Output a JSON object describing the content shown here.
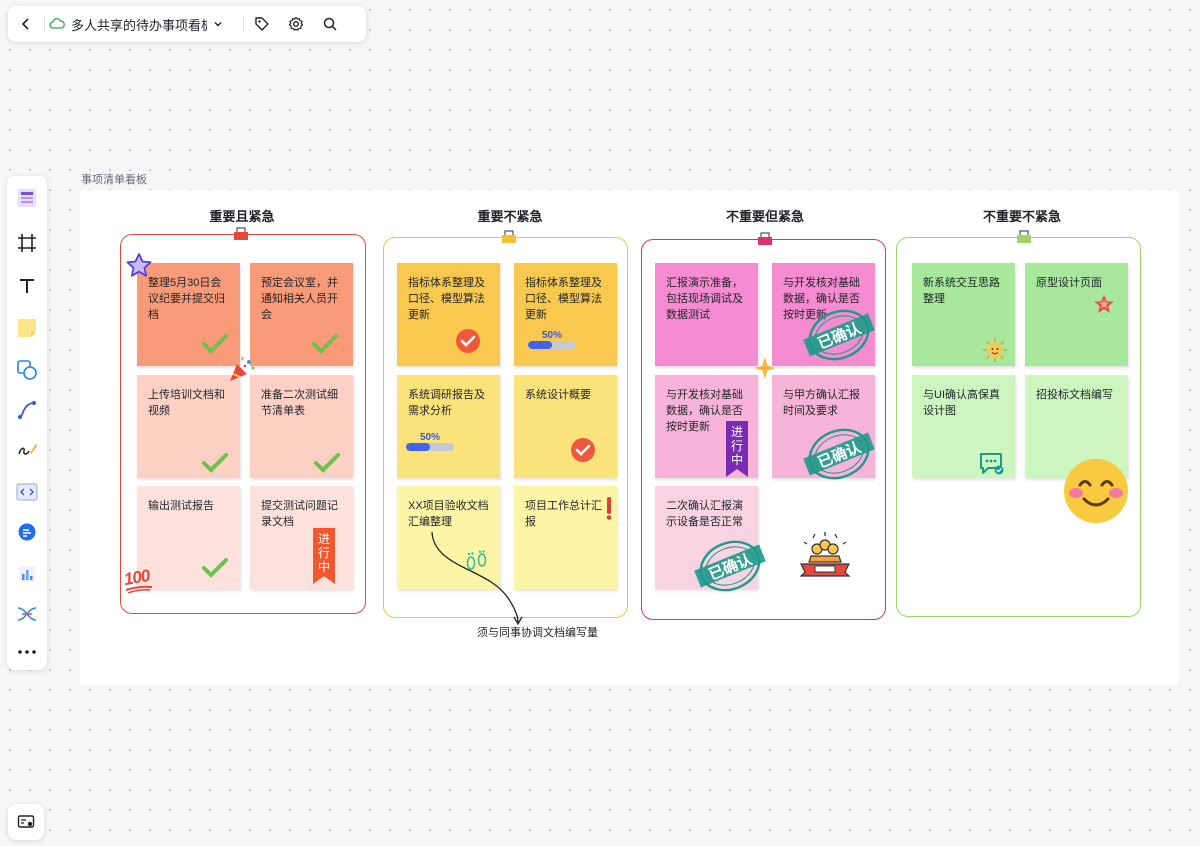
{
  "doc_title": "多人共享的待办事项看板-免费",
  "frame_label": "事项清单看板",
  "columns": [
    {
      "title": "重要且紧急",
      "color": "#e8473b"
    },
    {
      "title": "重要不紧急",
      "color": "#f2c230"
    },
    {
      "title": "不重要但紧急",
      "color": "#e0306f"
    },
    {
      "title": "不重要不紧急",
      "color": "#9ed36a"
    }
  ],
  "notes": {
    "c1": [
      "整理5月30日会议纪要并提交归档",
      "预定会议室，并通知相关人员开会",
      "上传培训文档和视频",
      "准备二次测试细节清单表",
      "输出测试报告",
      "提交测试问题记录文档"
    ],
    "c2": [
      "指标体系整理及口径、模型算法更新",
      "指标体系整理及口径、模型算法更新",
      "系统调研报告及需求分析",
      "系统设计概要",
      "XX项目验收文档汇编整理",
      "项目工作总计汇报"
    ],
    "c3": [
      "汇报演示准备，包括现场调试及数据测试",
      "与开发核对基础数据，确认是否按时更新",
      "与开发核对基础数据，确认是否按时更新",
      "与甲方确认汇报时间及要求",
      "二次确认汇报演示设备是否正常"
    ],
    "c4": [
      "新系统交互思路整理",
      "原型设计页面",
      "与UI确认高保真设计图",
      "招投标文档编写"
    ]
  },
  "progress": [
    {
      "label": "50%",
      "value": 0.5
    },
    {
      "label": "50%",
      "value": 0.5
    }
  ],
  "badges": {
    "in_progress": "进行中"
  },
  "stamps": {
    "confirmed": "已确认"
  },
  "stickers": {
    "hundred": "100"
  },
  "annotation": "须与同事协调文档编写量",
  "icons": {
    "back": "chevron-left-icon",
    "cloud": "cloud-icon",
    "dropdown": "chevron-down-icon",
    "tag": "tag-icon",
    "settings": "gear-icon",
    "search": "search-icon"
  }
}
